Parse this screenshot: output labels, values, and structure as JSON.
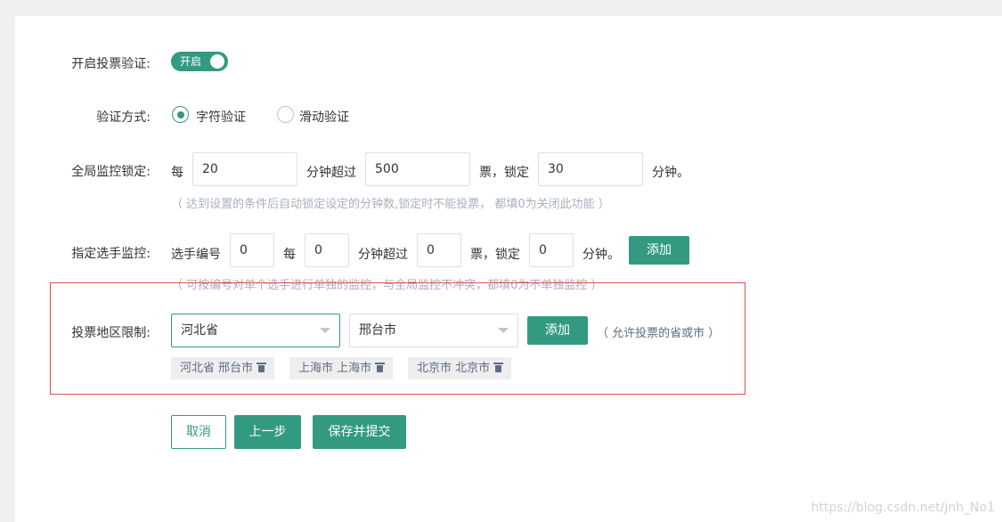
{
  "vote_verify": {
    "label": "开启投票验证:",
    "switch_text": "开启"
  },
  "verify_method": {
    "label": "验证方式:",
    "options": [
      "字符验证",
      "滑动验证"
    ]
  },
  "global_lock": {
    "label": "全局监控锁定:",
    "t1": "每",
    "minutes": "20",
    "t2": "分钟超过",
    "votes": "500",
    "t3": "票，锁定",
    "lock": "30",
    "t4": "分钟。",
    "hint": "（ 达到设置的条件后自动锁定设定的分钟数,锁定时不能投票， 都填0为关闭此功能 ）"
  },
  "contestant_lock": {
    "label": "指定选手监控:",
    "t0": "选手编号",
    "number": "0",
    "t1": "每",
    "minutes": "0",
    "t2": "分钟超过",
    "votes": "0",
    "t3": "票，锁定",
    "lock": "0",
    "t4": "分钟。",
    "add_label": "添加",
    "hint": "（ 可按编号对单个选手进行单独的监控，与全局监控不冲突，都填0为不单独监控 ）"
  },
  "region_limit": {
    "label": "投票地区限制:",
    "province": "河北省",
    "city": "邢台市",
    "add_label": "添加",
    "hint": "（ 允许投票的省或市 ）",
    "tags": [
      "河北省 邢台市",
      "上海市 上海市",
      "北京市 北京市"
    ]
  },
  "actions": {
    "cancel": "取消",
    "prev": "上一步",
    "submit": "保存并提交"
  },
  "watermark": "https://blog.csdn.net/jnh_No1"
}
